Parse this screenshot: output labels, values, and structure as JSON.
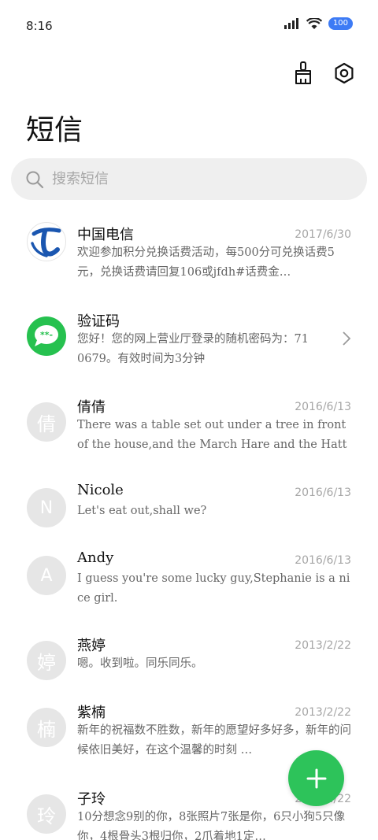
{
  "status": {
    "time": "8:16",
    "battery": "100"
  },
  "header": {
    "title": "短信",
    "clean_icon": "broom-icon",
    "settings_icon": "settings-icon"
  },
  "search": {
    "placeholder": "搜索短信"
  },
  "messages": [
    {
      "name": "中国电信",
      "date": "2017/6/30",
      "preview": "欢迎参加积分兑换话费活动，每500分可兑换话费5元，兑换话费请回复106或jfdh#话费金…",
      "avatar": "china-telecom-logo"
    },
    {
      "name": "验证码",
      "date": "",
      "preview": "您好！您的网上营业厅登录的随机密码为：710679。有效时间为3分钟",
      "avatar": "message-bubble-icon"
    },
    {
      "name": "倩倩",
      "date": "2016/6/13",
      "preview": "There was a table set out under a tree in front of the house,and the March Hare and the Hatter we…",
      "avatar": "倩"
    },
    {
      "name": "Nicole",
      "date": "2016/6/13",
      "preview": "Let's eat out,shall we?",
      "avatar": "N"
    },
    {
      "name": "Andy",
      "date": "2016/6/13",
      "preview": "I guess you're some lucky guy,Stephanie is a nice girl.",
      "avatar": "A"
    },
    {
      "name": "燕婷",
      "date": "2013/2/22",
      "preview": "嗯。收到啦。同乐同乐。",
      "avatar": "婷"
    },
    {
      "name": "紫楠",
      "date": "2013/2/22",
      "preview": "新年的祝福数不胜数，新年的愿望好多好多，新年的问候依旧美好，在这个温馨的时刻 …",
      "avatar": "楠"
    },
    {
      "name": "子玲",
      "date": "2013/2/22",
      "preview": "10分想念9别的你，8张照片7张是你，6只小狗5只像你，4根骨头3根归你，2爪着地1定…",
      "avatar": "玲"
    }
  ],
  "fab": {
    "icon": "plus-icon"
  },
  "colors": {
    "accent": "#2dc35a",
    "telecom_blue": "#1a56b0"
  }
}
